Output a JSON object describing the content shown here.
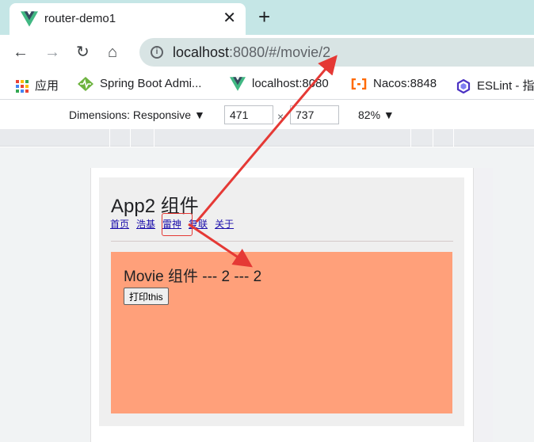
{
  "browser": {
    "tab_title": "router-demo1",
    "url_host": "localhost",
    "url_rest": ":8080/#/movie/2"
  },
  "bookmarks": [
    {
      "label": "应用",
      "icon": "apps-grid-icon"
    },
    {
      "label": "Spring Boot Admi...",
      "icon": "spring-boot-admin-icon"
    },
    {
      "label": "localhost:8080",
      "icon": "vue-icon"
    },
    {
      "label": "Nacos:8848",
      "icon": "nacos-icon"
    },
    {
      "label": "ESLint - 指",
      "icon": "eslint-icon"
    }
  ],
  "devtools": {
    "dimensions_label": "Dimensions: Responsive ▼",
    "width": "471",
    "height": "737",
    "times": "×",
    "zoom": "82% ▼"
  },
  "app": {
    "title": "App2 组件",
    "nav": [
      "首页",
      "浩基",
      "雷神",
      "复联",
      "关于"
    ],
    "movie_title": "Movie 组件 --- 2 --- 2",
    "print_button": "打印this"
  },
  "colors": {
    "tab_strip": "#c5e6e6",
    "movie_bg": "#ffa07a",
    "annotation_red": "#e53935"
  }
}
